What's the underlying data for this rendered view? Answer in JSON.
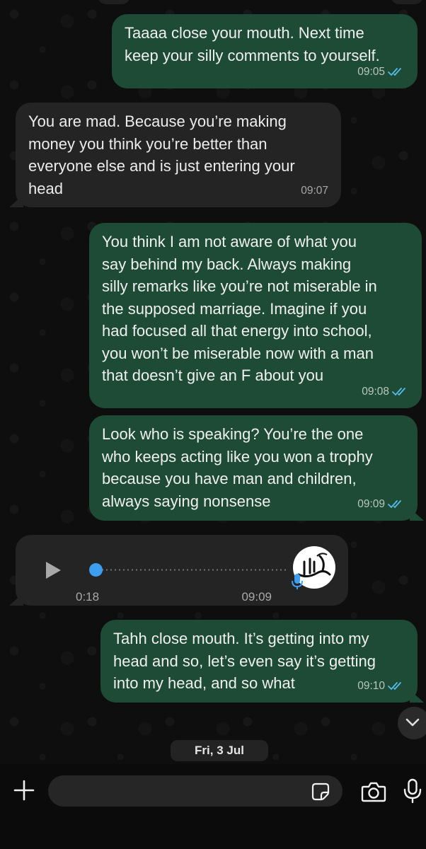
{
  "messages": [
    {
      "direction": "outgoing",
      "text": "Taaaa close your mouth. Next time\nkeep your silly comments to yourself.",
      "time": "09:05",
      "status": "read"
    },
    {
      "direction": "incoming",
      "text": "You are mad. Because you’re making\nmoney you think you’re better than\neveryone else and is just entering your\nhead",
      "time": "09:07"
    },
    {
      "direction": "outgoing",
      "text": "You think I am not aware of what you\nsay behind my back. Always making\nsilly remarks like you’re not miserable in\nthe supposed marriage. Imagine if you\nhad focused all that energy into school,\nyou won’t be miserable now with a man\nthat doesn’t give an F about you",
      "time": "09:08",
      "status": "read"
    },
    {
      "direction": "outgoing",
      "text": "Look who is speaking? You’re the one\nwho keeps acting like you won a trophy\nbecause you have man and children,\nalways saying nonsense",
      "time": "09:09",
      "status": "read"
    },
    {
      "direction": "outgoing",
      "text": "Tahh close mouth. It’s getting into my\nhead and so, let’s even say it’s getting\ninto my head, and so what",
      "time": "09:10",
      "status": "read"
    }
  ],
  "voice_note": {
    "duration": "0:18",
    "time": "09:09",
    "progress": 0.0,
    "avatar_text": "الله"
  },
  "date_divider": "Fri, 3 Jul",
  "composer": {
    "placeholder": ""
  },
  "icons": {
    "plus": "plus-icon",
    "sticker": "sticker-icon",
    "camera": "camera-icon",
    "mic": "microphone-icon",
    "scroll": "chevron-down-icon",
    "play": "play-icon",
    "read": "double-check-icon"
  },
  "colors": {
    "outgoing": "#1d4b35",
    "incoming": "#242424",
    "read_tick": "#53bdeb",
    "background": "#0b0b0b"
  }
}
